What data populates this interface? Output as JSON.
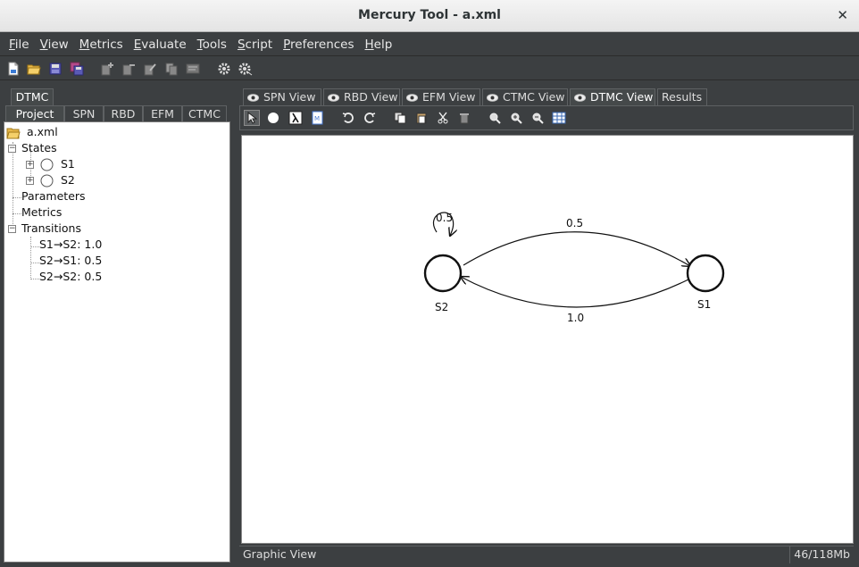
{
  "window": {
    "title": "Mercury Tool - a.xml",
    "close_glyph": "✕"
  },
  "menubar": {
    "items": [
      {
        "label": "File",
        "mnemonic": "F",
        "rest": "ile"
      },
      {
        "label": "View",
        "mnemonic": "V",
        "rest": "iew"
      },
      {
        "label": "Metrics",
        "mnemonic": "M",
        "rest": "etrics"
      },
      {
        "label": "Evaluate",
        "mnemonic": "E",
        "rest": "valuate"
      },
      {
        "label": "Tools",
        "mnemonic": "T",
        "rest": "ools"
      },
      {
        "label": "Script",
        "mnemonic": "S",
        "rest": "cript"
      },
      {
        "label": "Preferences",
        "mnemonic": "P",
        "rest": "references"
      },
      {
        "label": "Help",
        "mnemonic": "H",
        "rest": "elp"
      }
    ]
  },
  "toolbar": {
    "icons": [
      "new-file-icon",
      "open-folder-icon",
      "save-icon",
      "save-all-icon",
      "add-model-icon",
      "remove-model-icon",
      "edit-model-icon",
      "duplicate-model-icon",
      "properties-icon",
      "settings-gear-icon",
      "run-gear-icon"
    ]
  },
  "left_panel": {
    "top_tab": "DTMC",
    "tabs": [
      "Project",
      "SPN",
      "RBD",
      "EFM",
      "CTMC"
    ],
    "tree": {
      "root": "a.xml",
      "states_label": "States",
      "states": [
        "S1",
        "S2"
      ],
      "parameters_label": "Parameters",
      "metrics_label": "Metrics",
      "transitions_label": "Transitions",
      "transitions": [
        "S1→S2: 1.0",
        "S2→S1: 0.5",
        "S2→S2: 0.5"
      ]
    }
  },
  "right_panel": {
    "view_tabs": [
      "SPN View",
      "RBD View",
      "EFM View",
      "CTMC View",
      "DTMC View",
      "Results"
    ],
    "selected_view": "DTMC View",
    "canvas_tools": [
      "select-arrow-icon",
      "state-circle-icon",
      "lambda-icon",
      "model-doc-icon",
      "undo-icon",
      "redo-icon",
      "copy-icon",
      "paste-icon",
      "cut-icon",
      "delete-icon",
      "zoom-icon",
      "zoom-in-icon",
      "zoom-out-icon",
      "grid-icon"
    ],
    "status_left": "Graphic View",
    "status_right": "46/118Mb"
  },
  "graph": {
    "states": [
      {
        "name": "S2"
      },
      {
        "name": "S1"
      }
    ],
    "transitions": [
      {
        "from": "S2",
        "to": "S2",
        "probability": "0.5"
      },
      {
        "from": "S2",
        "to": "S1",
        "probability": "0.5"
      },
      {
        "from": "S1",
        "to": "S2",
        "probability": "1.0"
      }
    ]
  }
}
